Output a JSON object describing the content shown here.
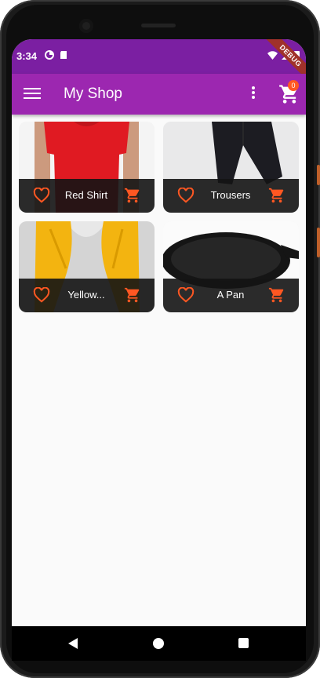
{
  "status_bar": {
    "time": "3:34",
    "debug_label": "DEBUG"
  },
  "app_bar": {
    "title": "My Shop",
    "cart_count": "0"
  },
  "products": [
    {
      "name": "Red Shirt",
      "image": "red-shirt"
    },
    {
      "name": "Trousers",
      "image": "trousers"
    },
    {
      "name": "Yellow...",
      "image": "yellow-scarf"
    },
    {
      "name": "A Pan",
      "image": "pan"
    }
  ],
  "colors": {
    "status_bar": "#7b1fa2",
    "app_bar": "#9c27b0",
    "accent": "#ff5722",
    "background": "#fafafa"
  },
  "nav_bar": {
    "icons": [
      "back-icon",
      "home-icon",
      "recents-icon"
    ]
  }
}
